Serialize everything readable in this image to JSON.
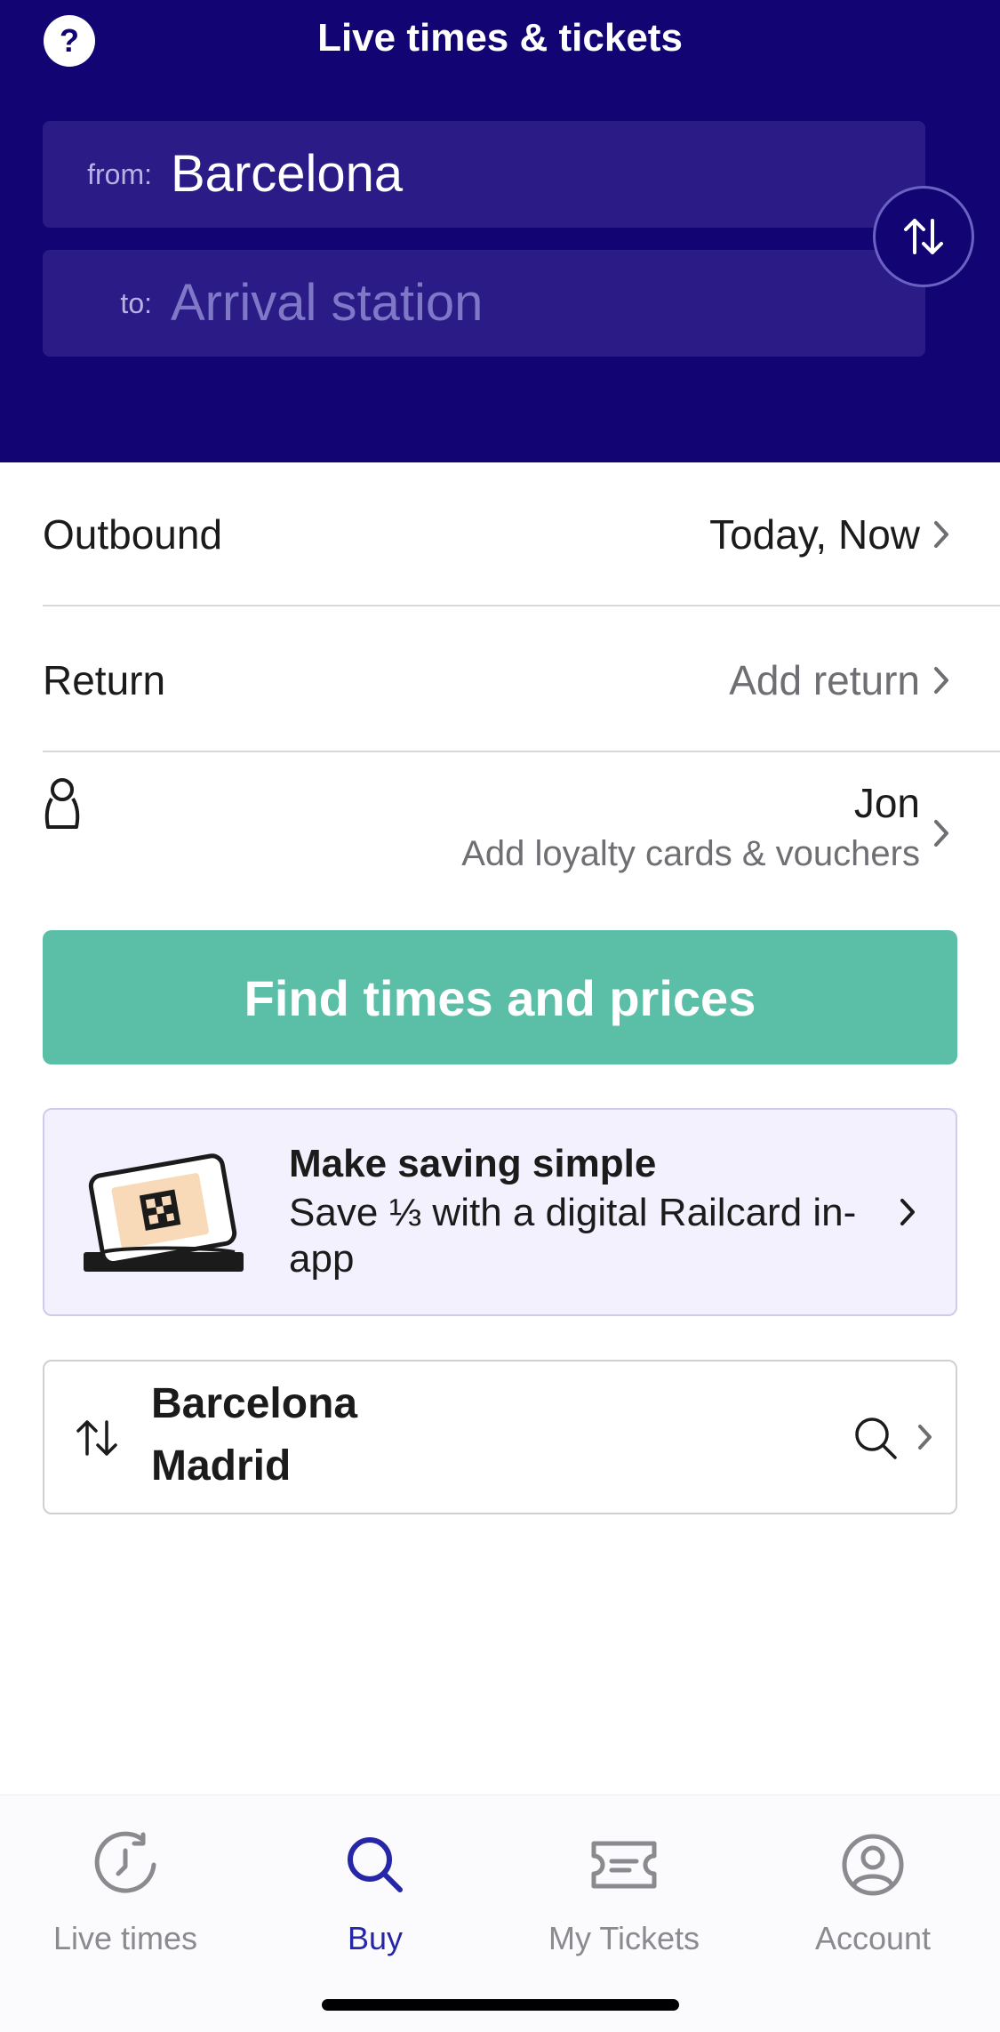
{
  "header": {
    "title": "Live times & tickets",
    "help_icon": "question-mark",
    "from_label": "from:",
    "from_value": "Barcelona",
    "to_label": "to:",
    "to_placeholder": "Arrival station",
    "swap_icon": "swap-vertical-arrows",
    "background_color": "#120473"
  },
  "journey": {
    "outbound_label": "Outbound",
    "outbound_value": "Today, Now",
    "return_label": "Return",
    "return_value": "Add return",
    "passenger_icon": "person",
    "passenger_name": "Jon",
    "passenger_sub": "Add loyalty cards & vouchers"
  },
  "find_button": {
    "label": "Find times and prices",
    "color": "#5bbfa7"
  },
  "promo": {
    "title": "Make saving simple",
    "text": "Save ⅓ with a digital Railcard in-app",
    "icon": "railcard-phone"
  },
  "recent_search": {
    "from": "Barcelona",
    "to": "Madrid",
    "swap_icon": "swap-arrows",
    "search_icon": "search"
  },
  "tabbar": {
    "tabs": [
      {
        "label": "Live times",
        "icon": "clock-refresh",
        "active": false
      },
      {
        "label": "Buy",
        "icon": "search",
        "active": true
      },
      {
        "label": "My Tickets",
        "icon": "ticket",
        "active": false
      },
      {
        "label": "Account",
        "icon": "user-circle",
        "active": false
      }
    ],
    "active_color": "#2626a8"
  }
}
